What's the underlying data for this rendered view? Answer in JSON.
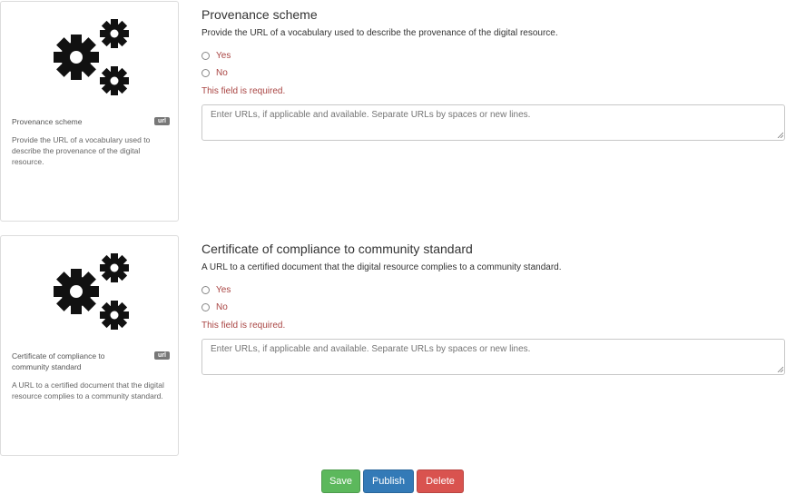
{
  "fields": [
    {
      "card_title": "Provenance scheme",
      "card_badge": "url",
      "card_description": "Provide the URL of a vocabulary used to describe the provenance of the digital resource.",
      "title": "Provenance scheme",
      "description": "Provide the URL of a vocabulary used to describe the provenance of the digital resource.",
      "options": [
        "Yes",
        "No"
      ],
      "error": "This field is required.",
      "urls_placeholder": "Enter URLs, if applicable and available. Separate URLs by spaces or new lines.",
      "icon": "gears-icon"
    },
    {
      "card_title": "Certificate of compliance to community standard",
      "card_badge": "url",
      "card_description": "A URL to a certified document that the digital resource complies to a community standard.",
      "title": "Certificate of compliance to community standard",
      "description": "A URL to a certified document that the digital resource complies to a community standard.",
      "options": [
        "Yes",
        "No"
      ],
      "error": "This field is required.",
      "urls_placeholder": "Enter URLs, if applicable and available. Separate URLs by spaces or new lines.",
      "icon": "gears-icon"
    }
  ],
  "actions": {
    "save_label": "Save",
    "publish_label": "Publish",
    "delete_label": "Delete"
  },
  "colors": {
    "save": "#5cb85c",
    "publish": "#337ab7",
    "delete": "#d9534f",
    "error": "#a94442",
    "badge": "#777777"
  }
}
